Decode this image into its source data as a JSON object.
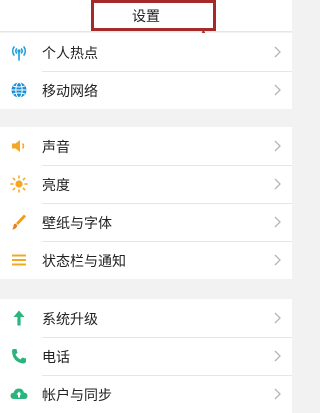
{
  "header": {
    "title": "设置"
  },
  "colors": {
    "highlight": "#a52a2a",
    "hotspot": "#1aa0d8",
    "network": "#1a8fd8",
    "sound": "#f5a623",
    "brightness": "#f5a623",
    "wallpaper": "#f39c12",
    "statusbar": "#f5a623",
    "upgrade": "#2ab57d",
    "phone": "#2ab57d",
    "account": "#2ab57d"
  },
  "sections": [
    {
      "items": [
        {
          "label": "个人热点",
          "icon": "hotspot-icon"
        },
        {
          "label": "移动网络",
          "icon": "globe-icon"
        }
      ]
    },
    {
      "items": [
        {
          "label": "声音",
          "icon": "speaker-icon"
        },
        {
          "label": "亮度",
          "icon": "sun-icon"
        },
        {
          "label": "壁纸与字体",
          "icon": "brush-icon"
        },
        {
          "label": "状态栏与通知",
          "icon": "list-icon"
        }
      ]
    },
    {
      "items": [
        {
          "label": "系统升级",
          "icon": "arrow-up-icon"
        },
        {
          "label": "电话",
          "icon": "phone-icon"
        },
        {
          "label": "帐户与同步",
          "icon": "cloud-icon"
        }
      ]
    }
  ]
}
